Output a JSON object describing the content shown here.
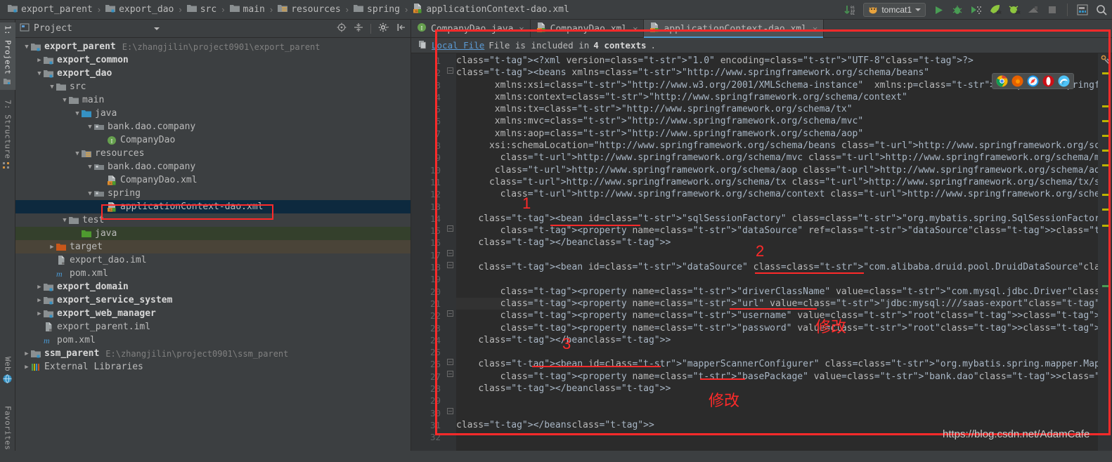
{
  "breadcrumb": [
    {
      "label": "export_parent",
      "icon": "module-icon"
    },
    {
      "label": "export_dao",
      "icon": "module-icon"
    },
    {
      "label": "src",
      "icon": "folder-icon"
    },
    {
      "label": "main",
      "icon": "folder-icon"
    },
    {
      "label": "resources",
      "icon": "resources-folder-icon"
    },
    {
      "label": "spring",
      "icon": "folder-icon"
    },
    {
      "label": "applicationContext-dao.xml",
      "icon": "xml-file-icon"
    }
  ],
  "toolbar": {
    "run_config": "tomcat1",
    "icons": [
      "update-icon",
      "run-icon",
      "debug-icon",
      "run-coverage-icon",
      "jrebel-run-icon",
      "jrebel-debug-icon",
      "attach-profiler-icon",
      "stop-icon",
      "layout-icon",
      "search-icon"
    ]
  },
  "vertical_tabs": [
    {
      "label": "1: Project",
      "icon": "project-icon",
      "selected": true
    },
    {
      "label": "7: Structure",
      "icon": "structure-icon",
      "selected": false
    },
    {
      "label": "Web",
      "icon": "web-icon",
      "selected": false
    },
    {
      "label": "Favorites",
      "icon": "favorites-icon",
      "selected": false
    }
  ],
  "project_panel": {
    "title": "Project",
    "header_icons": [
      "locate-icon",
      "collapse-all-icon",
      "settings-gear-icon",
      "hide-icon"
    ],
    "tree": [
      {
        "depth": 0,
        "arrow": "down",
        "icon": "module-icon",
        "label": "export_parent",
        "bold": true,
        "path": "E:\\zhangjilin\\project0901\\export_parent",
        "state": "normal"
      },
      {
        "depth": 1,
        "arrow": "right",
        "icon": "module-icon",
        "label": "export_common",
        "bold": true,
        "path": "",
        "state": "normal"
      },
      {
        "depth": 1,
        "arrow": "down",
        "icon": "module-icon",
        "label": "export_dao",
        "bold": true,
        "path": "",
        "state": "normal"
      },
      {
        "depth": 2,
        "arrow": "down",
        "icon": "folder-icon",
        "label": "src",
        "bold": false,
        "path": "",
        "state": "normal"
      },
      {
        "depth": 3,
        "arrow": "down",
        "icon": "folder-icon",
        "label": "main",
        "bold": false,
        "path": "",
        "state": "normal"
      },
      {
        "depth": 4,
        "arrow": "down",
        "icon": "source-folder-icon",
        "label": "java",
        "bold": false,
        "path": "",
        "state": "normal"
      },
      {
        "depth": 5,
        "arrow": "down",
        "icon": "package-icon",
        "label": "bank.dao.company",
        "bold": false,
        "path": "",
        "state": "normal"
      },
      {
        "depth": 6,
        "arrow": "none",
        "icon": "interface-icon",
        "label": "CompanyDao",
        "bold": false,
        "path": "",
        "state": "normal"
      },
      {
        "depth": 4,
        "arrow": "down",
        "icon": "resources-folder-icon",
        "label": "resources",
        "bold": false,
        "path": "",
        "state": "normal"
      },
      {
        "depth": 5,
        "arrow": "down",
        "icon": "package-icon",
        "label": "bank.dao.company",
        "bold": false,
        "path": "",
        "state": "normal"
      },
      {
        "depth": 6,
        "arrow": "none",
        "icon": "xml-file-icon",
        "label": "CompanyDao.xml",
        "bold": false,
        "path": "",
        "state": "normal"
      },
      {
        "depth": 5,
        "arrow": "down",
        "icon": "package-icon",
        "label": "spring",
        "bold": false,
        "path": "",
        "state": "normal"
      },
      {
        "depth": 6,
        "arrow": "none",
        "icon": "xml-file-icon",
        "label": "applicationContext-dao.xml",
        "bold": false,
        "path": "",
        "state": "selected"
      },
      {
        "depth": 3,
        "arrow": "down",
        "icon": "folder-icon",
        "label": "test",
        "bold": false,
        "path": "",
        "state": "normal"
      },
      {
        "depth": 4,
        "arrow": "none",
        "icon": "test-source-folder-icon",
        "label": "java",
        "bold": false,
        "path": "",
        "state": "green"
      },
      {
        "depth": 2,
        "arrow": "right",
        "icon": "target-folder-icon",
        "label": "target",
        "bold": false,
        "path": "",
        "state": "brown"
      },
      {
        "depth": 2,
        "arrow": "none",
        "icon": "iml-file-icon",
        "label": "export_dao.iml",
        "bold": false,
        "path": "",
        "state": "normal"
      },
      {
        "depth": 2,
        "arrow": "none",
        "icon": "maven-pom-icon",
        "label": "pom.xml",
        "bold": false,
        "path": "",
        "state": "normal"
      },
      {
        "depth": 1,
        "arrow": "right",
        "icon": "module-icon",
        "label": "export_domain",
        "bold": true,
        "path": "",
        "state": "normal"
      },
      {
        "depth": 1,
        "arrow": "right",
        "icon": "module-icon",
        "label": "export_service_system",
        "bold": true,
        "path": "",
        "state": "normal"
      },
      {
        "depth": 1,
        "arrow": "right",
        "icon": "module-icon",
        "label": "export_web_manager",
        "bold": true,
        "path": "",
        "state": "normal"
      },
      {
        "depth": 1,
        "arrow": "none",
        "icon": "iml-file-icon",
        "label": "export_parent.iml",
        "bold": false,
        "path": "",
        "state": "normal"
      },
      {
        "depth": 1,
        "arrow": "none",
        "icon": "maven-pom-icon",
        "label": "pom.xml",
        "bold": false,
        "path": "",
        "state": "normal"
      },
      {
        "depth": 0,
        "arrow": "right",
        "icon": "module-icon",
        "label": "ssm_parent",
        "bold": true,
        "path": "E:\\zhangjilin\\project0901\\ssm_parent",
        "state": "normal"
      },
      {
        "depth": 0,
        "arrow": "right",
        "icon": "libraries-icon",
        "label": "External Libraries",
        "bold": false,
        "path": "",
        "state": "normal"
      }
    ]
  },
  "editor": {
    "tabs": [
      {
        "label": "CompanyDao.java",
        "icon": "interface-icon",
        "active": false
      },
      {
        "label": "CompanyDao.xml",
        "icon": "xml-file-icon",
        "active": false
      },
      {
        "label": "applicationContext-dao.xml",
        "icon": "xml-file-icon",
        "active": true
      }
    ],
    "banner": {
      "icon": "copy-file-icon",
      "link": "Local File",
      "text_before": " File is included in ",
      "count": "4 contexts",
      "text_after": "."
    },
    "line_numbers": [
      "1",
      "2",
      "3",
      "4",
      "5",
      "6",
      "7",
      "8",
      "9",
      "10",
      "11",
      "12",
      "13",
      "14",
      "15",
      "16",
      "17",
      "18",
      "19",
      "20",
      "21",
      "22",
      "23",
      "24",
      "25",
      "26",
      "27",
      "28",
      "29",
      "30",
      "31",
      "32"
    ],
    "code_lines": [
      "<?xml version=\"1.0\" encoding=\"UTF-8\"?>",
      "<beans xmlns=\"http://www.springframework.org/schema/beans\"",
      "       xmlns:xsi=\"http://www.w3.org/2001/XMLSchema-instance\"  xmlns:p=\"http://www.springframework.org/schema/p\"",
      "       xmlns:context=\"http://www.springframework.org/schema/context\"",
      "       xmlns:tx=\"http://www.springframework.org/schema/tx\"",
      "       xmlns:mvc=\"http://www.springframework.org/schema/mvc\"",
      "       xmlns:aop=\"http://www.springframework.org/schema/aop\"",
      "      xsi:schemaLocation=\"http://www.springframework.org/schema/beans http://www.springframework.org/schema/beans/spring-beans.xsd",
      "        http://www.springframework.org/schema/mvc http://www.springframework.org/schema/mvc/spring-mvc.xsd",
      "       http://www.springframework.org/schema/aop http://www.springframework.org/schema/aop/spring-aop.xsd",
      "      http://www.springframework.org/schema/tx http://www.springframework.org/schema/tx/spring-tx.xsd",
      "        http://www.springframework.org/schema/context http://www.springframework.org/schema/context/spring-context.xsd\">",
      "",
      "    <bean id=\"sqlSessionFactory\" class=\"org.mybatis.spring.SqlSessionFactoryBean\">",
      "        <property name=\"dataSource\" ref=\"dataSource\"></property>",
      "    </bean>",
      "",
      "    <bean id=\"dataSource\" class=\"com.alibaba.druid.pool.DruidDataSource\">",
      "",
      "        <property name=\"driverClassName\" value=\"com.mysql.jdbc.Driver\"></property>",
      "        <property name=\"url\" value=\"jdbc:mysql:///saas-export\"></property>",
      "        <property name=\"username\" value=\"root\"></property>",
      "        <property name=\"password\" value=\"root\"></property>",
      "    </bean>",
      "",
      "    <bean id=\"mapperScannerConfigurer\" class=\"org.mybatis.spring.mapper.MapperScannerConfigurer\">",
      "        <property name=\"basePackage\" value=\"bank.dao\"></property>",
      "    </bean>",
      "",
      "",
      "</beans>",
      ""
    ]
  },
  "annotations": {
    "marker_1": "1",
    "marker_2": "2",
    "marker_3": "3",
    "note_1": "修改",
    "note_2": "修改"
  },
  "watermark": "https://blog.csdn.net/AdamCafe",
  "colors": {
    "accent": "#4a9ad4",
    "annotation_red": "#ff2a2a",
    "selection_blue": "#0d293e",
    "editor_bg": "#2b2b2b",
    "panel_bg": "#3c3f41"
  }
}
